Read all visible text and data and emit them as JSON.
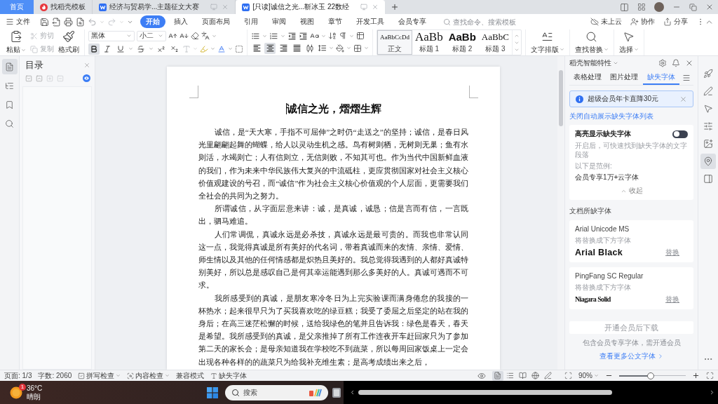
{
  "title_bar": {
    "tabs": [
      {
        "kind": "home",
        "label": "首页",
        "selected": false
      },
      {
        "kind": "template",
        "label": "找稻壳模板",
        "selected": false
      },
      {
        "kind": "document",
        "label": "经济与贸易学...主题征文大赛",
        "selected": false
      },
      {
        "kind": "document",
        "label": "[只读]诚信之光...靳冰玉 22数经",
        "selected": true
      }
    ]
  },
  "menu_bar": {
    "file": "文件",
    "tabs": [
      {
        "label": "开始",
        "selected": true
      },
      {
        "label": "插入",
        "selected": false
      },
      {
        "label": "页面布局",
        "selected": false
      },
      {
        "label": "引用",
        "selected": false
      },
      {
        "label": "审阅",
        "selected": false
      },
      {
        "label": "视图",
        "selected": false
      },
      {
        "label": "章节",
        "selected": false
      },
      {
        "label": "开发工具",
        "selected": false
      },
      {
        "label": "会员专享",
        "selected": false
      }
    ],
    "search": {
      "placeholder": "查找命令、搜索模板"
    },
    "actions": [
      {
        "kind": "cloud",
        "label": "未上云"
      },
      {
        "kind": "collaborate",
        "label": "协作"
      },
      {
        "kind": "share",
        "label": "分享"
      }
    ]
  },
  "ribbon": {
    "paste": "粘贴",
    "clipboard": [
      {
        "kind": "cut",
        "label": "剪切",
        "disabled": true
      },
      {
        "kind": "copy",
        "label": "复制",
        "disabled": true
      }
    ],
    "format_painter": "格式刷",
    "font": {
      "name": "黑体",
      "size": "小二"
    },
    "text_format": [
      {
        "kind": "bold",
        "selected": true
      },
      {
        "kind": "italic",
        "selected": false
      },
      {
        "kind": "underline",
        "selected": false
      },
      {
        "kind": "strikethrough",
        "selected": false
      },
      {
        "kind": "superscript",
        "selected": false
      },
      {
        "kind": "subscript",
        "selected": false
      }
    ],
    "alignment": [
      {
        "kind": "left",
        "selected": false
      },
      {
        "kind": "center",
        "selected": true
      },
      {
        "kind": "right",
        "selected": false
      },
      {
        "kind": "justify",
        "selected": false
      },
      {
        "kind": "distributed",
        "selected": false
      }
    ],
    "styles": [
      {
        "kind": "body",
        "sample": "AaBbCcDd",
        "label": "正文",
        "selected": true
      },
      {
        "kind": "heading1",
        "sample": "AaBb",
        "label": "标题 1",
        "selected": false
      },
      {
        "kind": "heading2",
        "sample": "AaBb",
        "label": "标题 2",
        "selected": false
      },
      {
        "kind": "heading3",
        "sample": "AaBbC",
        "label": "标题 3",
        "selected": false
      }
    ],
    "tools": [
      {
        "kind": "text-layout",
        "label": "文字排版"
      },
      {
        "kind": "find-replace",
        "label": "查找替换"
      },
      {
        "kind": "select",
        "label": "选择"
      }
    ]
  },
  "left_rail": [
    {
      "kind": "outline",
      "selected": true
    },
    {
      "kind": "navigation",
      "selected": false
    },
    {
      "kind": "bookmark",
      "selected": false
    },
    {
      "kind": "search",
      "selected": false
    }
  ],
  "toc_panel": {
    "title": "目录"
  },
  "document": {
    "title": "诚信之光，熠熠生辉",
    "paragraphs": [
      "诚信，是“天大寒，手指不可屈伸”之时仍“走送之”的坚持；诚信，是春日风光里翩翩起舞的蝴蝶，给人以灵动生机之感。鸟有树则栖，无树则无巢；鱼有水则活，水竭则亡；人有信则立，无信则败，不知其可也。作为当代中国新鲜血液的我们，作为未来中华民族伟大复兴的中流砥柱，更应贯彻国家对社会主义核心价值观建设的号召，而“诚信”作为社会主义核心价值观的个人层面，更需要我们全社会的共同为之努力。",
      "所谓诚信，从字面层意来讲：诚，是真诚，诚恳；信是言而有信，一言既出，驷马难追。",
      "人们常调侃，真诚永远是必杀技，真诚永远是最可贵的。而我也非常认同这一点，我觉得真诚是所有美好的代名词，带着真诚而来的友情、亲情、爱情、师生情以及其他的任何情感都是炽热且美好的。我总觉得我遇到的人都好真诚特别美好，所以总是感叹自己是何其幸运能遇到那么多美好的人。真诚可遇而不可求。",
      "我所感受到的真诚，是朋友寒冷冬日为上完实验课而满身倦怠的我接的一杯热水；起来很早只为了买我喜欢吃的绿豆糕；我受了委屈之后坚定的站在我的身后；在高三迷茫松懈的时候，送给我绿色的笔并且告诉我：绿色是春天，春天是希望。我所感受到的真诚，是父亲推掉了所有工作连夜开车赶回家只为了参加第二天的家长会；是母亲知道我在学校吃不到蔬菜，所以每周回家饭桌上一定会出现各种各样的的蔬菜只为给我补充维生素；是高考成绩出来之后，"
    ]
  },
  "right_panel": {
    "title": "稻壳智能特性",
    "tabs": [
      {
        "label": "表格处理",
        "selected": false
      },
      {
        "label": "图片处理",
        "selected": false
      },
      {
        "label": "缺失字体",
        "selected": true
      }
    ],
    "banner": "超级会员年卡直降30元",
    "link": "关闭自动展示缺失字体列表",
    "highlight": {
      "label": "高亮显示缺失字体",
      "on": false,
      "description": "开启后，可快速找到缺失字体的文字段落",
      "example_label": "以下是范例:",
      "example": "会员专享1万+云字体",
      "collapse": "收起"
    },
    "section_label": "文档所缺字体",
    "missing_fonts": [
      {
        "name": "Arial Unicode MS",
        "note": "将替换成下方字体",
        "replacement": "Arial Black",
        "kind": "black",
        "action": "替换"
      },
      {
        "name": "PingFang SC Regular",
        "note": "将替换成下方字体",
        "replacement": "Niagara Solid",
        "kind": "condensed",
        "action": "替换"
      }
    ],
    "download_button": "开通会员后下载",
    "member_note": "包含会员专享字体，需开通会员",
    "more_link": "查看更多公文字体"
  },
  "right_rail": [
    {
      "kind": "rocket",
      "selected": false
    },
    {
      "kind": "pen",
      "selected": false
    },
    {
      "kind": "pointer",
      "selected": false
    },
    {
      "kind": "sliders",
      "selected": false
    },
    {
      "kind": "image",
      "selected": false
    },
    {
      "kind": "pin",
      "selected": true
    },
    {
      "kind": "panel",
      "selected": false
    }
  ],
  "status_bar": {
    "page": "页面: 1/3",
    "words": "字数: 2060",
    "checks": [
      {
        "kind": "spell",
        "label": "拼写检查"
      },
      {
        "kind": "content",
        "label": "内容检查"
      }
    ],
    "mode": "兼容模式",
    "missing_fonts": "缺失字体",
    "view_modes": [
      {
        "kind": "page",
        "selected": true
      },
      {
        "kind": "outline",
        "selected": false
      },
      {
        "kind": "reading",
        "selected": false
      },
      {
        "kind": "web",
        "selected": false
      },
      {
        "kind": "write",
        "selected": false
      }
    ],
    "zoom": "90%",
    "zoom_slider": {
      "level": 0.47
    }
  },
  "taskbar": {
    "weather": {
      "temperature": "36°C",
      "condition": "晴朗",
      "badge": "1"
    },
    "search": {
      "placeholder": "搜索"
    }
  }
}
